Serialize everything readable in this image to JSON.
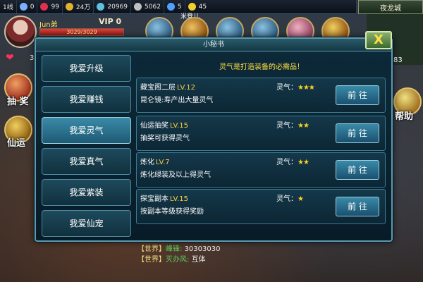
{
  "topbar": {
    "channel": "1线",
    "diamond": "0",
    "ruby": "99",
    "gold": "24万",
    "silver": "20969",
    "honor": "5062",
    "gem": "5",
    "hearts": "45"
  },
  "map_name": "夜龙城",
  "minimap_value": "83",
  "player": {
    "name": "Jun弟",
    "vip": "VIP 0",
    "hp": "3029/3029",
    "hp_fraction": 1.0,
    "side_value": "3"
  },
  "rank_label": "米登儿",
  "side_buttons": {
    "lottery": "抽 奖",
    "fortune": "仙运",
    "help": "帮助"
  },
  "dialog": {
    "title": "小秘书",
    "close": "X",
    "subtitle": "灵气是打造装备的必需品！",
    "tabs": [
      "我爱升级",
      "我爱赚钱",
      "我爱灵气",
      "我爱真气",
      "我爱紫装",
      "我爱仙宠"
    ],
    "active_tab": 2,
    "entries": [
      {
        "name": "藏宝阁二层",
        "level": "LV.12",
        "desc": "昆仑镜:寿产出大量灵气",
        "lq_label": "灵气：",
        "stars": "★★★",
        "button": "前 往"
      },
      {
        "name": "仙运抽奖",
        "level": "LV.15",
        "desc": "抽奖可获得灵气",
        "lq_label": "灵气：",
        "stars": "★★",
        "button": "前 往"
      },
      {
        "name": "炼化",
        "level": "LV.7",
        "desc": "炼化绿装及以上得灵气",
        "lq_label": "灵气：",
        "stars": "★★",
        "button": "前 往"
      },
      {
        "name": "探宝副本",
        "level": "LV.15",
        "desc": "按副本等级获得奖励",
        "lq_label": "灵气：",
        "stars": "★",
        "button": "前 往"
      }
    ]
  },
  "chat": [
    {
      "channel": "【世界】",
      "name": "峰锋:",
      "text": "30303030"
    },
    {
      "channel": "【世界】",
      "name": "灭办风:",
      "text": "互体"
    }
  ],
  "colors": {
    "accent_gold": "#ffd040",
    "dialog_bg": "#0d2a3a",
    "tab_active": "#3a8aa8"
  }
}
